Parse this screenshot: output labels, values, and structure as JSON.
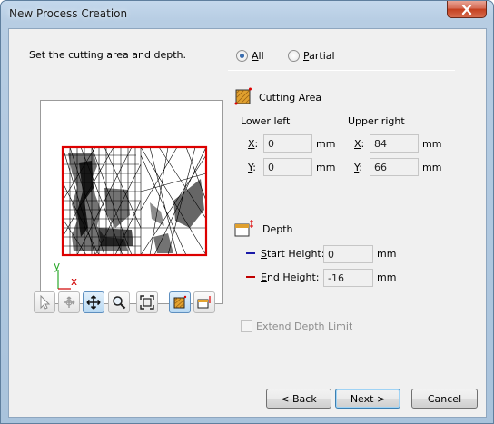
{
  "window": {
    "title": "New Process Creation"
  },
  "instructions": "Set the cutting area and depth.",
  "area_mode": {
    "options": [
      {
        "label": "All",
        "selected": true
      },
      {
        "label": "Partial",
        "selected": false
      }
    ]
  },
  "cutting_area": {
    "label": "Cutting Area",
    "lower_left_label": "Lower left",
    "upper_right_label": "Upper right",
    "x_label": "X:",
    "y_label": "Y:",
    "unit": "mm",
    "lower_left": {
      "x": "0",
      "y": "0"
    },
    "upper_right": {
      "x": "84",
      "y": "66"
    }
  },
  "depth": {
    "label": "Depth",
    "start_label": "Start Height:",
    "start_value": "0",
    "end_label": "End Height:",
    "end_value": "-16",
    "unit": "mm",
    "start_color": "#1a1aa8",
    "end_color": "#c00000"
  },
  "preview": {
    "axis_y": "y",
    "axis_x": "x",
    "boundary_color": "#dd0000"
  },
  "toolbar": {
    "tools": [
      "select-arrow-icon",
      "pan-rotate-icon",
      "move-icon",
      "zoom-icon",
      "fit-view-icon",
      "cutting-area-tool-icon",
      "depth-tool-icon"
    ],
    "active": [
      "move-icon",
      "cutting-area-tool-icon"
    ]
  },
  "extend_depth": {
    "label": "Extend Depth Limit",
    "checked": false,
    "enabled": false
  },
  "buttons": {
    "back": "< Back",
    "next": "Next >",
    "cancel": "Cancel"
  }
}
